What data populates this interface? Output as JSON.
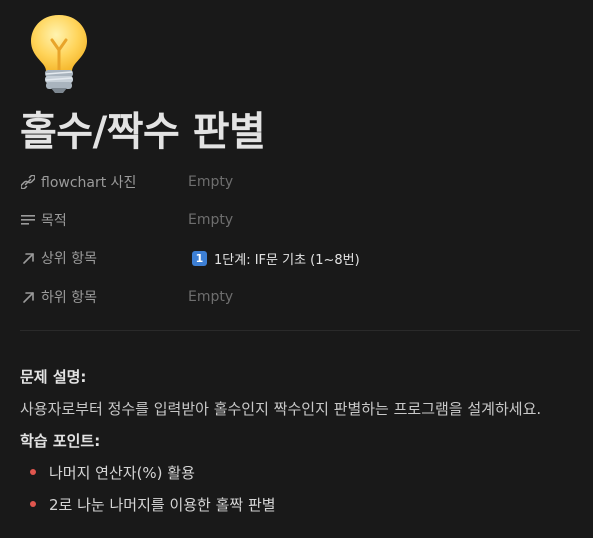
{
  "page": {
    "icon": "lightbulb-icon",
    "title": "홀수/짝수 판별"
  },
  "properties": [
    {
      "icon": "link-icon",
      "key": "flowchart 사진",
      "value": "Empty",
      "empty": true
    },
    {
      "icon": "text-lines-icon",
      "key": "목적",
      "value": "Empty",
      "empty": true
    },
    {
      "icon": "arrow-up-right-icon",
      "key": "상위 항목",
      "value": "1단계: IF문 기초 (1~8번)",
      "badge": "1",
      "empty": false
    },
    {
      "icon": "arrow-up-right-icon",
      "key": "하위 항목",
      "value": "Empty",
      "empty": true
    }
  ],
  "content": {
    "heading1": "문제 설명:",
    "description": "사용자로부터 정수를 입력받아 홀수인지 짝수인지 판별하는 프로그램을 설계하세요.",
    "heading2": "학습 포인트:",
    "bullets": [
      "나머지 연산자(%) 활용",
      "2로 나눈 나머지를 이용한 홀짝 판별"
    ]
  },
  "colors": {
    "background": "#191919",
    "bullet": "#e0564e",
    "badge": "#3d7fd4"
  }
}
